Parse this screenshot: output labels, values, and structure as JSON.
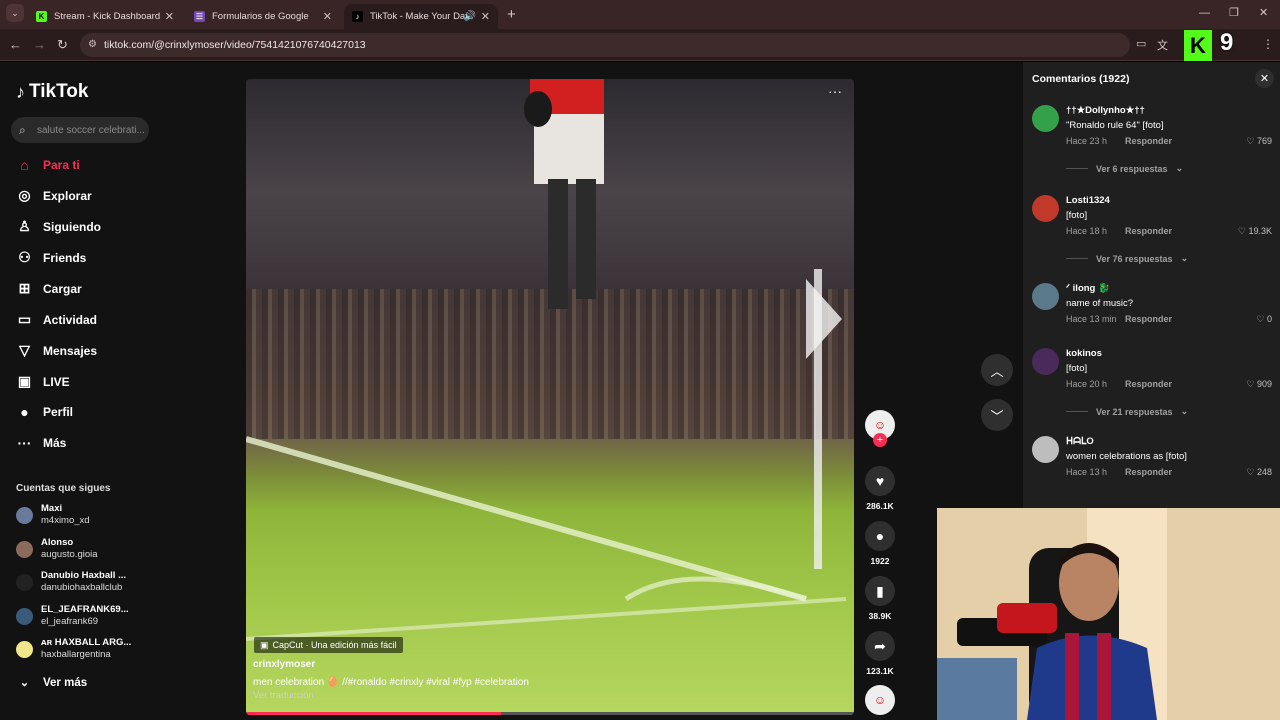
{
  "browser": {
    "tabs": [
      {
        "title": "Stream - Kick Dashboard",
        "fav": "K",
        "fav_color": "#53fc18"
      },
      {
        "title": "Formularios de Google",
        "fav": "☰",
        "fav_color": "#7248b9"
      },
      {
        "title": "TikTok - Make Your Day",
        "fav": "♪",
        "fav_color": "#000000"
      }
    ],
    "url": "tiktok.com/@crinxlymoser/video/7541421076740427013"
  },
  "overlay": {
    "kick_badge": "K",
    "kick_number": "9"
  },
  "sidebar": {
    "logo": "TikTok",
    "search_placeholder": "salute soccer celebrati...",
    "nav": [
      {
        "label": "Para ti",
        "icon": "home-icon",
        "glyph": "⌂"
      },
      {
        "label": "Explorar",
        "icon": "compass-icon",
        "glyph": "◎"
      },
      {
        "label": "Siguiendo",
        "icon": "following-icon",
        "glyph": "♙"
      },
      {
        "label": "Friends",
        "icon": "friends-icon",
        "glyph": "⚇"
      },
      {
        "label": "Cargar",
        "icon": "upload-icon",
        "glyph": "⊞"
      },
      {
        "label": "Actividad",
        "icon": "activity-icon",
        "glyph": "▭"
      },
      {
        "label": "Mensajes",
        "icon": "messages-icon",
        "glyph": "▽"
      },
      {
        "label": "LIVE",
        "icon": "live-icon",
        "glyph": "▣"
      },
      {
        "label": "Perfil",
        "icon": "profile-icon",
        "glyph": "●"
      },
      {
        "label": "Más",
        "icon": "more-icon",
        "glyph": "···"
      }
    ],
    "following_title": "Cuentas que sigues",
    "following": [
      {
        "name": "Maxi",
        "user": "m4ximo_xd"
      },
      {
        "name": "Alonso",
        "user": "augusto.gioia"
      },
      {
        "name": "Danubio Haxball ...",
        "user": "danubiohaxballclub"
      },
      {
        "name": "EL_JEAFRANK69...",
        "user": "el_jeafrank69"
      },
      {
        "name": "ᴀʀ HAXBALL ARG...",
        "user": "haxballargentina"
      }
    ],
    "see_more": "Ver más"
  },
  "video": {
    "capcut": "CapCut · Una edición más fácil",
    "username": "crinxlymoser",
    "caption": "men celebration 🥚 //#ronaldo #crinxly #viral #fyp #celebration",
    "translate": "Ver traducción",
    "progress": 0.42
  },
  "actions": {
    "likes": "286.1K",
    "comments": "1922",
    "saves": "38.9K",
    "shares": "123.1K"
  },
  "comments": {
    "title": "Comentarios (1922)",
    "items": [
      {
        "user": "††★Dollynho★††",
        "text": "\"Ronaldo rule 64\" [foto]",
        "date": "Hace 23 h",
        "reply": "Responder",
        "likes": "769",
        "replies": "Ver 6 respuestas",
        "color": "#35a04a"
      },
      {
        "user": "Losti1324",
        "text": "[foto]",
        "date": "Hace 18 h",
        "reply": "Responder",
        "likes": "19.3K",
        "replies": "Ver 76 respuestas",
        "color": "#c0392b"
      },
      {
        "user": "ᐟ ilong 🐉",
        "text": "name of music?",
        "date": "Hace 13 min",
        "reply": "Responder",
        "likes": "0",
        "replies": "",
        "color": "#5a7a8a"
      },
      {
        "user": "kokinos",
        "text": "[foto]",
        "date": "Hace 20 h",
        "reply": "Responder",
        "likes": "909",
        "replies": "Ver 21 respuestas",
        "color": "#4a2a5a"
      },
      {
        "user": "ᕼᗩᒪO",
        "text": "women celebrations as [foto]",
        "date": "Hace 13 h",
        "reply": "Responder",
        "likes": "248",
        "replies": "",
        "color": "#bdbdbd"
      }
    ]
  }
}
